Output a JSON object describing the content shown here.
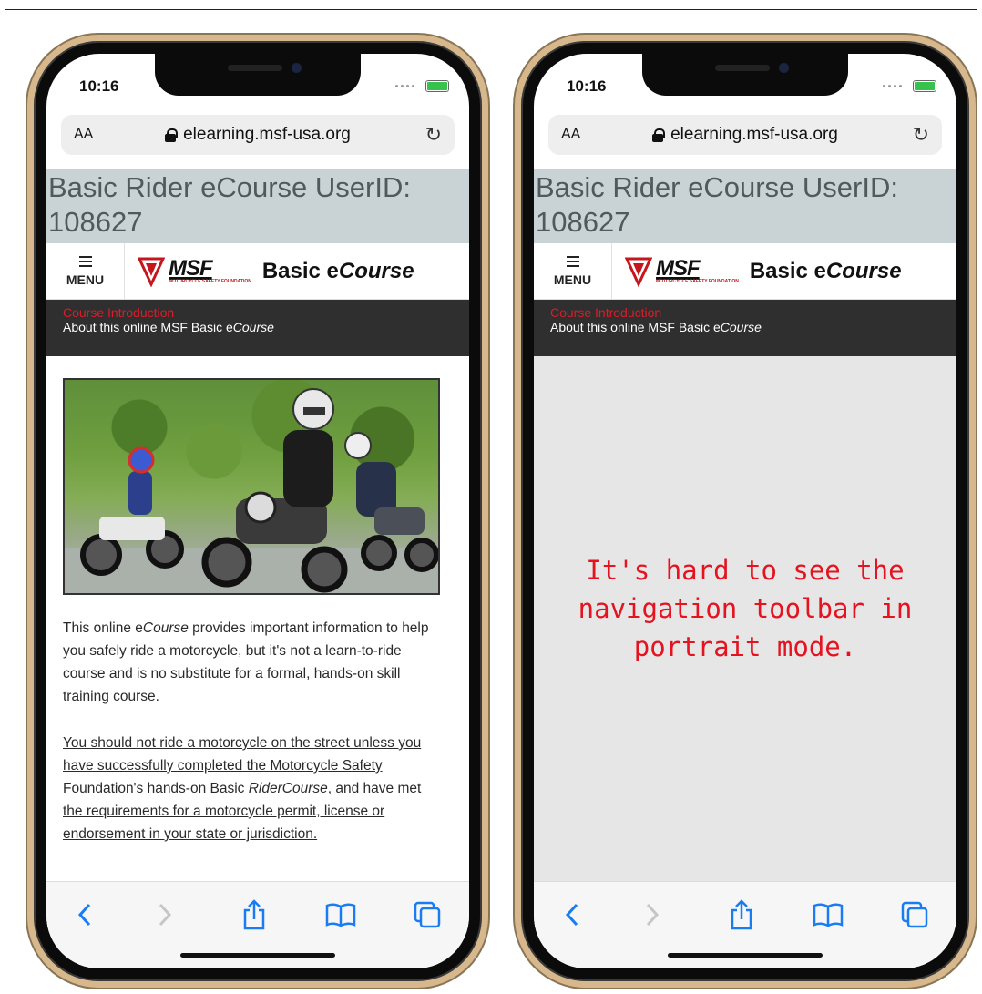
{
  "phones": [
    {
      "status": {
        "time": "10:16"
      },
      "browser": {
        "aa_label": "AA",
        "url": "elearning.msf-usa.org"
      },
      "page_title": "Basic Rider eCourse UserID: 108627",
      "header": {
        "menu_label": "MENU",
        "logo_text": "MSF",
        "logo_subtext": "MOTORCYCLE SAFETY FOUNDATION",
        "course_prefix": "Basic e",
        "course_suffix": "Course"
      },
      "breadcrumb": {
        "section": "Course Introduction",
        "page_prefix": "About this online MSF Basic e",
        "page_suffix": "Course"
      },
      "content": {
        "p1_prefix": "This online e",
        "p1_em": "Course",
        "p1_rest": " provides important information to help you safely ride a motorcycle, but it's not a learn-to-ride course and is no substitute for a formal, hands-on skill training course.",
        "p2_link_a": "You should not ride a motorcycle on the street unless you have successfully completed the Motorcycle Safety Foundation's hands-on Basic ",
        "p2_link_em": "RiderCourse",
        "p2_rest": ", and have met the requirements for a motorcycle permit, license or endorsement in your state or jurisdiction."
      }
    },
    {
      "status": {
        "time": "10:16"
      },
      "browser": {
        "aa_label": "AA",
        "url": "elearning.msf-usa.org"
      },
      "page_title": "Basic Rider eCourse UserID: 108627",
      "header": {
        "menu_label": "MENU",
        "logo_text": "MSF",
        "logo_subtext": "MOTORCYCLE SAFETY FOUNDATION",
        "course_prefix": "Basic e",
        "course_suffix": "Course"
      },
      "breadcrumb": {
        "section": "Course Introduction",
        "page_prefix": "About this online MSF Basic e",
        "page_suffix": "Course"
      },
      "annotation": "It's hard to see the navigation toolbar in portrait mode."
    }
  ],
  "toolbar_icons": [
    "back-icon",
    "forward-icon",
    "share-icon",
    "bookmarks-icon",
    "tabs-icon"
  ],
  "colors": {
    "accent": "#1a7cf2",
    "annotation": "#e4131f",
    "breadcrumb_section": "#d81e2a",
    "title_bar": "#c9d3d6"
  }
}
